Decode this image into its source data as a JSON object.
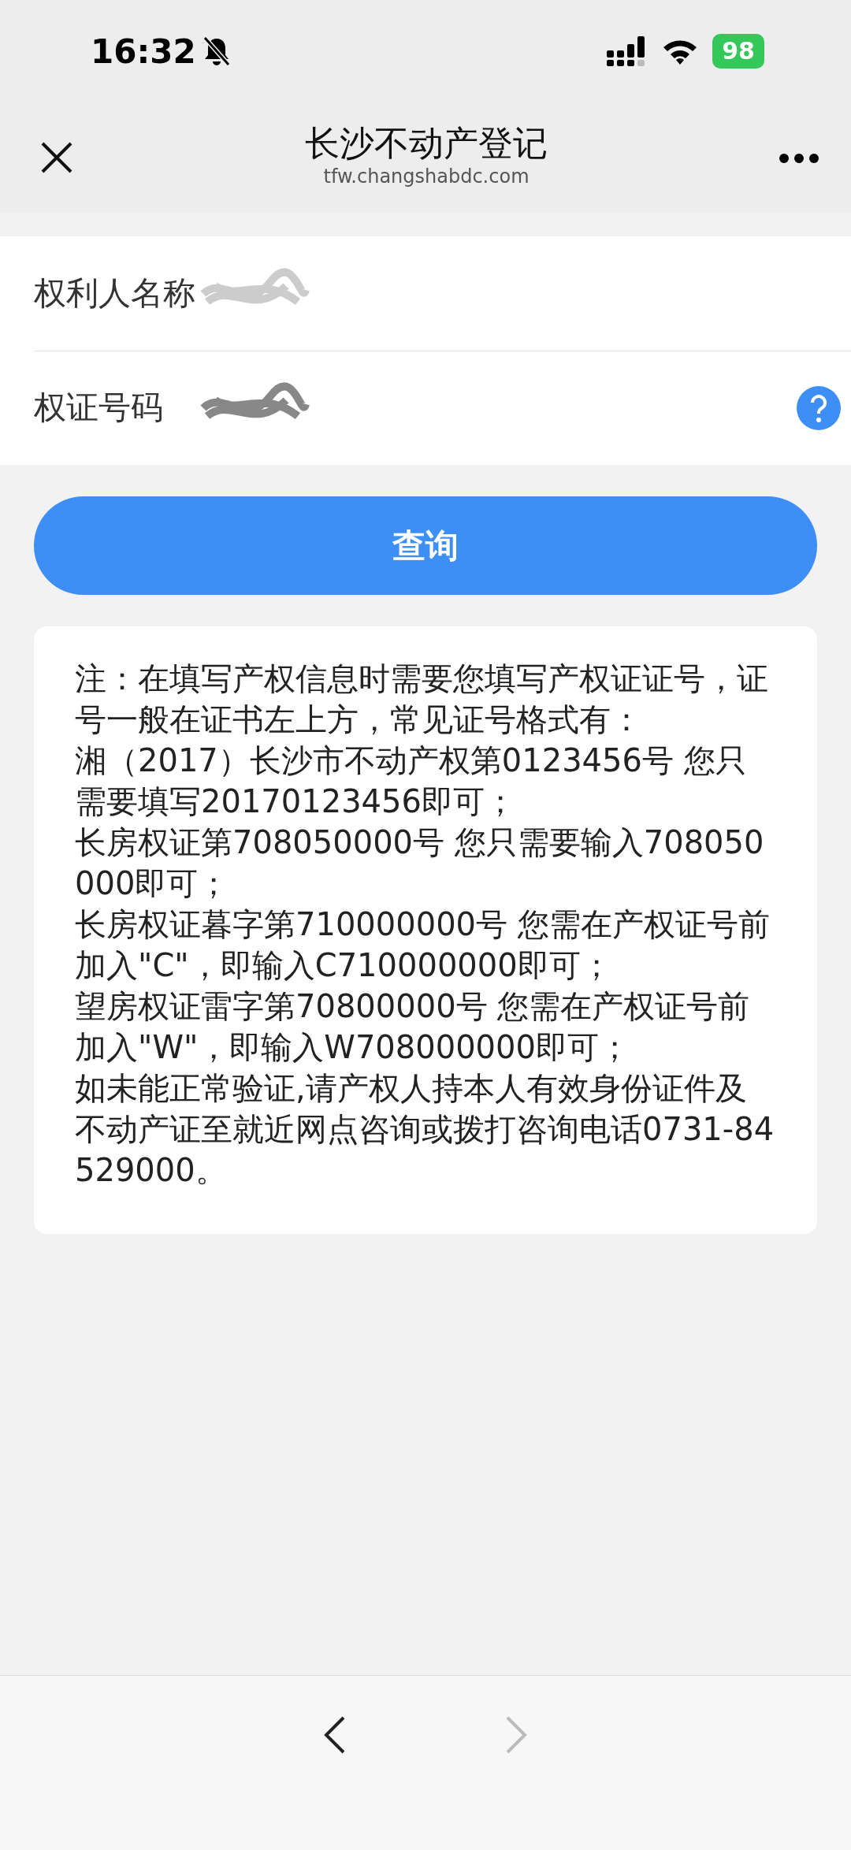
{
  "status_bar": {
    "time": "16:32",
    "battery": "98"
  },
  "header": {
    "title": "长沙不动产登记",
    "url": "tfw.changshabdc.com"
  },
  "form": {
    "fields": [
      {
        "label": "权利人名称",
        "help": false
      },
      {
        "label": "权证号码",
        "help": true
      }
    ]
  },
  "query_button": "查询",
  "note": [
    "注：在填写产权信息时需要您填写产权证证号，证号一般在证书左上方，常见证号格式有：",
    "湘（2017）长沙市不动产权第0123456号 您只需要填写20170123456即可；",
    "长房权证第708050000号 您只需要输入708050000即可；",
    "长房权证暮字第710000000号 您需在产权证号前加入\"C\"，即输入C710000000即可；",
    "望房权证雷字第70800000号 您需在产权证号前加入\"W\"，即输入W708000000即可；",
    "如未能正常验证,请产权人持本人有效身份证件及不动产证至就近网点咨询或拨打咨询电话0731-84529000。"
  ],
  "nav": {
    "back_disabled": false,
    "forward_disabled": true
  }
}
